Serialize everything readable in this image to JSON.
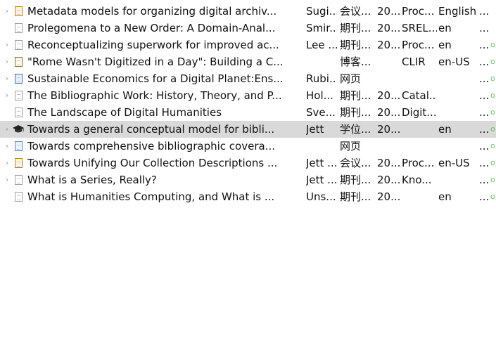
{
  "items": [
    {
      "twisty": "›",
      "icon": "conference-paper-icon",
      "icon_class": "conf",
      "title": "Metadata models for organizing digital archiv...",
      "creator": "Sugi...",
      "type": "会议...",
      "year": "20...",
      "publication": "Proc...",
      "language": "English",
      "more": "...",
      "extra": "",
      "selected": false
    },
    {
      "twisty": "",
      "icon": "journal-article-icon",
      "icon_class": "",
      "title": "Prolegomena to a New Order: A Domain-Anal...",
      "creator": "Smir...",
      "type": "期刊...",
      "year": "20...",
      "publication": "SREL...",
      "language": "en",
      "more": "...",
      "extra": "",
      "selected": false
    },
    {
      "twisty": "›",
      "icon": "journal-article-icon",
      "icon_class": "",
      "title": "Reconceptualizing superwork for improved ac...",
      "creator": "Lee ...",
      "type": "期刊...",
      "year": "20...",
      "publication": "Proc...",
      "language": "en",
      "more": "...",
      "extra": "o",
      "selected": false
    },
    {
      "twisty": "›",
      "icon": "blog-post-icon",
      "icon_class": "blog",
      "title": "\"Rome Wasn't Digitized in a Day\": Building a C...",
      "creator": "",
      "type": "博客...",
      "year": "",
      "publication": "CLIR",
      "language": "en-US",
      "more": "...",
      "extra": "o",
      "selected": false
    },
    {
      "twisty": "›",
      "icon": "book-icon",
      "icon_class": "book",
      "title": "Sustainable Economics for a Digital Planet:Ens...",
      "creator": "Rubi...",
      "type": "网页",
      "year": "",
      "publication": "",
      "language": "",
      "more": "...",
      "extra": "o",
      "selected": false
    },
    {
      "twisty": "›",
      "icon": "journal-article-icon",
      "icon_class": "",
      "title": "The Bibliographic Work: History, Theory, and P...",
      "creator": "Hol...",
      "type": "期刊...",
      "year": "20...",
      "publication": "Catal...",
      "language": "",
      "more": "...",
      "extra": "o",
      "selected": false
    },
    {
      "twisty": "",
      "icon": "journal-article-icon",
      "icon_class": "",
      "title": "The Landscape of Digital Humanities",
      "creator": "Sve...",
      "type": "期刊...",
      "year": "20...",
      "publication": "Digit...",
      "language": "",
      "more": "...",
      "extra": "o",
      "selected": false
    },
    {
      "twisty": "›",
      "icon": "thesis-icon",
      "icon_class": "",
      "title": "Towards a general conceptual model for bibli...",
      "creator": "Jett",
      "type": "学位...",
      "year": "20...",
      "publication": "",
      "language": "en",
      "more": "...",
      "extra": "o",
      "selected": true
    },
    {
      "twisty": "›",
      "icon": "web-page-icon",
      "icon_class": "web",
      "title": "Towards comprehensive bibliographic covera...",
      "creator": "",
      "type": "网页",
      "year": "",
      "publication": "",
      "language": "",
      "more": "...",
      "extra": "o",
      "selected": false
    },
    {
      "twisty": "›",
      "icon": "conference-paper-icon",
      "icon_class": "conf",
      "title": "Towards Unifying Our Collection Descriptions ...",
      "creator": "Jett ...",
      "type": "会议...",
      "year": "20...",
      "publication": "Proc...",
      "language": "en-US",
      "more": "...",
      "extra": "o",
      "selected": false
    },
    {
      "twisty": "›",
      "icon": "journal-article-icon",
      "icon_class": "",
      "title": "What is a Series, Really?",
      "creator": "Jett ...",
      "type": "期刊...",
      "year": "20...",
      "publication": "Kno...",
      "language": "",
      "more": "...",
      "extra": "o",
      "selected": false
    },
    {
      "twisty": "",
      "icon": "journal-article-icon",
      "icon_class": "",
      "title": "What is Humanities Computing, and What is ...",
      "creator": "Uns...",
      "type": "期刊...",
      "year": "20...",
      "publication": "",
      "language": "en",
      "more": "...",
      "extra": "o",
      "selected": false
    }
  ]
}
